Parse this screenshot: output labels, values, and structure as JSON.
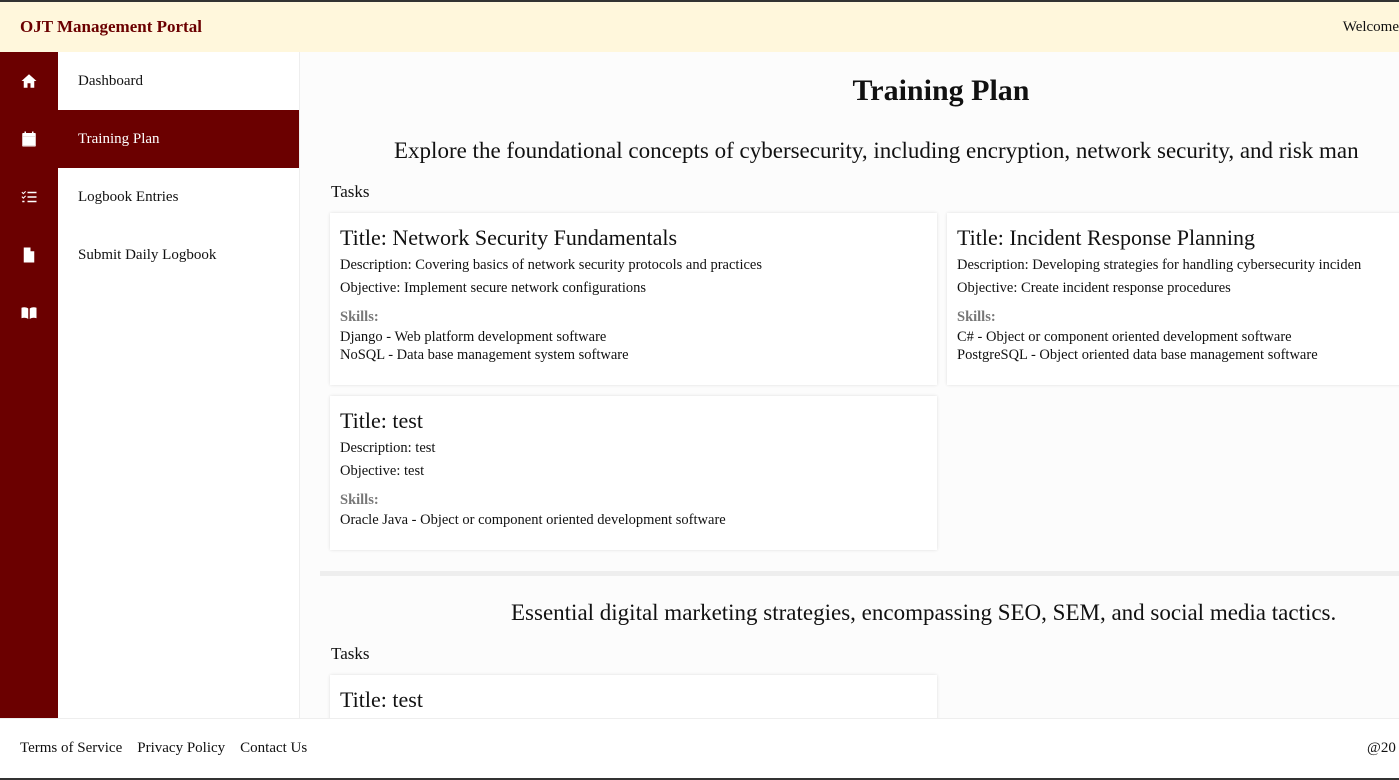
{
  "header": {
    "brand": "OJT Management Portal",
    "welcome": "Welcome, Moar"
  },
  "icon_rail": [
    {
      "icon": "home-icon"
    },
    {
      "icon": "calendar-icon"
    },
    {
      "icon": "checklist-icon"
    },
    {
      "icon": "document-icon"
    },
    {
      "icon": "book-icon"
    }
  ],
  "menu": {
    "items": [
      {
        "label": "Dashboard"
      },
      {
        "label": "Training Plan"
      },
      {
        "label": "Logbook Entries"
      },
      {
        "label": "Submit Daily Logbook"
      }
    ],
    "active": "Training Plan"
  },
  "main": {
    "title": "Training Plan",
    "plans": [
      {
        "description": "Explore the foundational concepts of cybersecurity, including encryption, network security, and risk man",
        "tasks_label": "Tasks",
        "tasks": [
          {
            "title": "Title: Network Security Fundamentals",
            "description": "Description: Covering basics of network security protocols and practices",
            "objective": "Objective: Implement secure network configurations",
            "skills_label": "Skills:",
            "skills": [
              "Django - Web platform development software",
              "NoSQL - Data base management system software"
            ]
          },
          {
            "title": "Title: Incident Response Planning",
            "description": "Description: Developing strategies for handling cybersecurity inciden",
            "objective": "Objective: Create incident response procedures",
            "skills_label": "Skills:",
            "skills": [
              "C# - Object or component oriented development software",
              "PostgreSQL - Object oriented data base management software"
            ]
          },
          {
            "title": "Title: test",
            "description": "Description: test",
            "objective": "Objective: test",
            "skills_label": "Skills:",
            "skills": [
              "Oracle Java - Object or component oriented development software"
            ]
          }
        ]
      },
      {
        "description": "Essential digital marketing strategies, encompassing SEO, SEM, and social media tactics.",
        "tasks_label": "Tasks",
        "tasks": [
          {
            "title": "Title: test"
          }
        ]
      }
    ]
  },
  "footer": {
    "links": [
      "Terms of Service",
      "Privacy Policy",
      "Contact Us"
    ],
    "copyright": "@20"
  },
  "colors": {
    "brand": "#6b0000",
    "header_bg": "#fff7dc"
  }
}
